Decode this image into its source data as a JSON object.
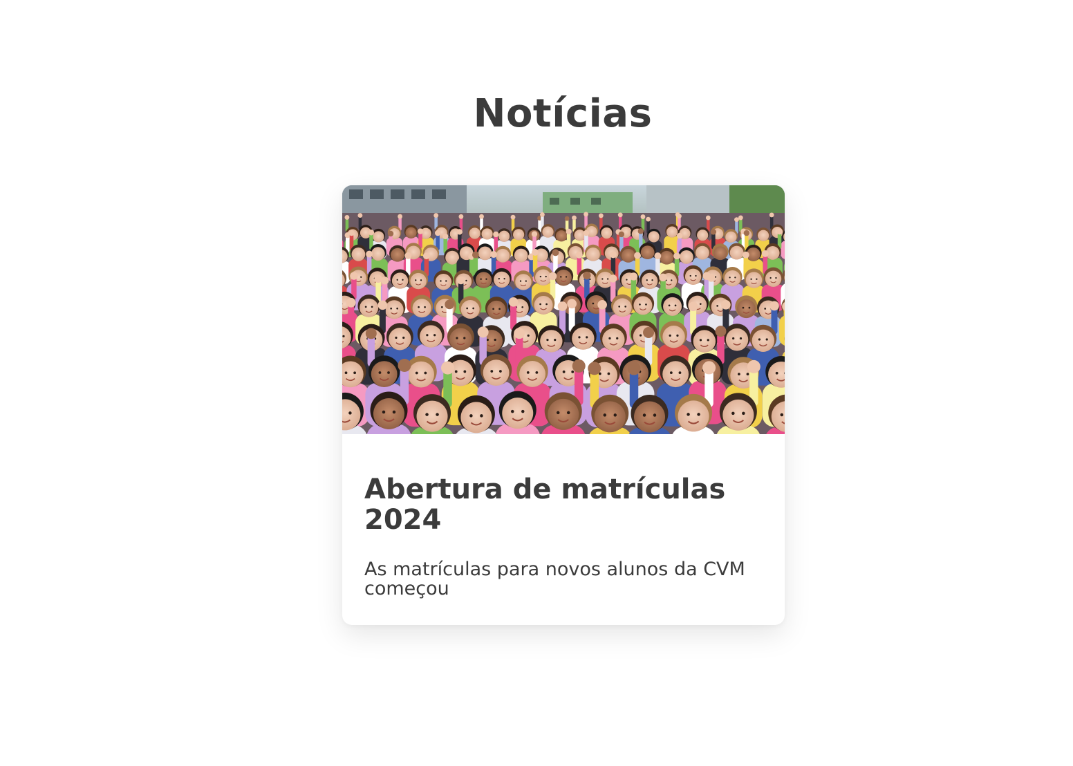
{
  "section": {
    "title": "Notícias"
  },
  "news": [
    {
      "image_subject": "crowd of children waving in a schoolyard",
      "title": "Abertura de matrículas 2024",
      "summary": "As matrículas para novos alunos da CVM começou"
    }
  ],
  "colors": {
    "text": "#3b3b3b",
    "background": "#ffffff",
    "card": "#ffffff"
  }
}
